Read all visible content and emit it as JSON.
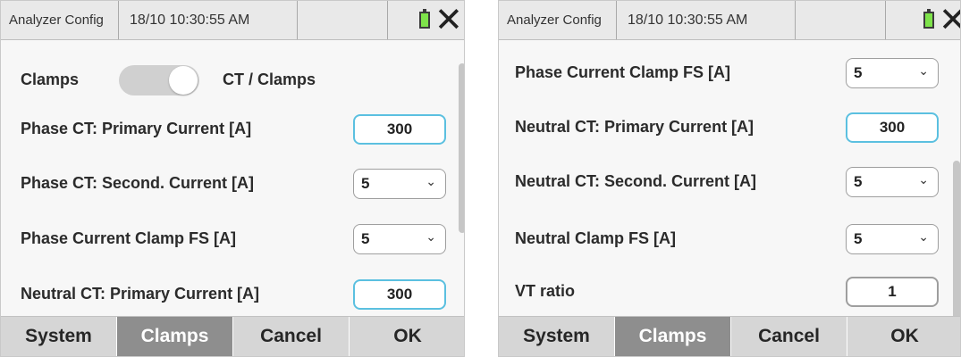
{
  "left": {
    "titlebar": {
      "app": "Analyzer Config",
      "time": "18/10 10:30:55 AM"
    },
    "toggle_row": {
      "label": "Clamps",
      "right_label": "CT / Clamps"
    },
    "rows": [
      {
        "label": "Phase CT: Primary Current  [A]",
        "value": "300"
      },
      {
        "label": "Phase CT: Second. Current [A]",
        "value": "5"
      },
      {
        "label": "Phase Current Clamp FS [A]",
        "value": "5"
      },
      {
        "label": "Neutral CT: Primary Current [A]",
        "value": "300"
      }
    ],
    "buttons": {
      "system": "System",
      "clamps": "Clamps",
      "cancel": "Cancel",
      "ok": "OK"
    }
  },
  "right": {
    "titlebar": {
      "app": "Analyzer Config",
      "time": "18/10 10:30:55 AM"
    },
    "rows": [
      {
        "label": "Phase Current Clamp FS [A]",
        "value": "5"
      },
      {
        "label": "Neutral CT: Primary Current [A]",
        "value": "300"
      },
      {
        "label": "Neutral CT: Second. Current [A]",
        "value": "5"
      },
      {
        "label": "Neutral Clamp FS [A]",
        "value": "5"
      },
      {
        "label": "VT ratio",
        "value": "1"
      }
    ],
    "buttons": {
      "system": "System",
      "clamps": "Clamps",
      "cancel": "Cancel",
      "ok": "OK"
    }
  },
  "icons": {
    "battery": "battery-icon",
    "close": "close-icon",
    "dropdown": "chevron-down-icon"
  },
  "colors": {
    "input_focus_border": "#5bc0e0",
    "active_tab": "#8e8e8e",
    "battery": "#7ee34a"
  }
}
